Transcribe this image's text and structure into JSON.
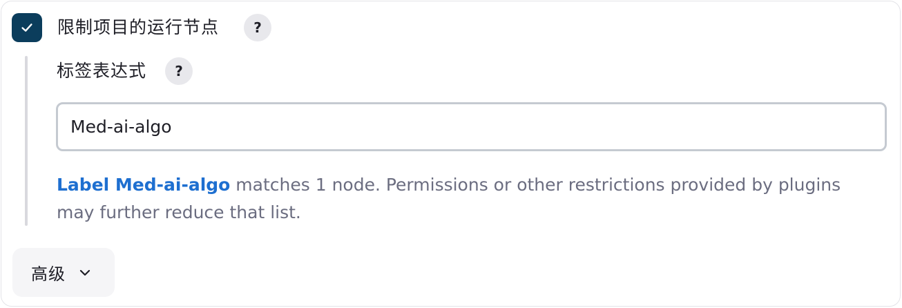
{
  "restrict_node": {
    "checked": true,
    "label": "限制项目的运行节点",
    "help_glyph": "?"
  },
  "label_expression": {
    "label": "标签表达式",
    "help_glyph": "?",
    "value": "Med-ai-algo"
  },
  "validation": {
    "link_text": "Label Med-ai-algo",
    "message": " matches 1 node. Permissions or other restrictions provided by plugins may further reduce that list."
  },
  "advanced": {
    "label": "高级"
  },
  "colors": {
    "checkbox_bg": "#0b3d5c",
    "link": "#1e6fd0",
    "muted_text": "#6b6d80"
  },
  "icons": {
    "checkbox": "check-icon",
    "help": "question-mark-icon",
    "advanced": "chevron-down-icon"
  }
}
